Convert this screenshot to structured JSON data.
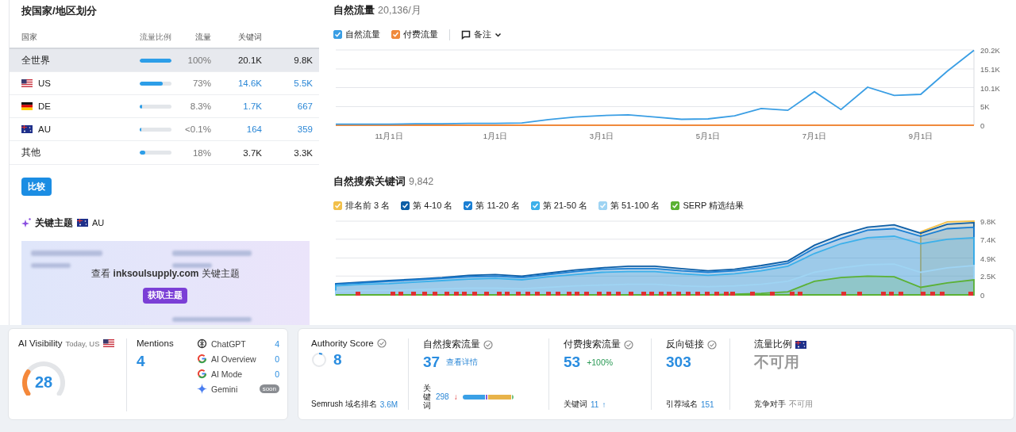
{
  "country_panel": {
    "title": "按国家/地区划分",
    "columns": [
      "国家",
      "流量比例",
      "流量",
      "关键词"
    ],
    "rows": [
      {
        "name": "全世界",
        "level": 1,
        "share": "100%",
        "traffic": "20.1K",
        "keywords": "9.8K",
        "linked": false,
        "selected": true
      },
      {
        "name": "US",
        "level": 0.73,
        "share": "73%",
        "traffic": "14.6K",
        "keywords": "5.5K",
        "linked": true,
        "selected": false
      },
      {
        "name": "DE",
        "level": 0.083,
        "share": "8.3%",
        "traffic": "1.7K",
        "keywords": "667",
        "linked": true,
        "selected": false
      },
      {
        "name": "AU",
        "level": 0.01,
        "share": "<0.1%",
        "traffic": "164",
        "keywords": "359",
        "linked": true,
        "selected": false
      },
      {
        "name": "其他",
        "level": 0.18,
        "share": "18%",
        "traffic": "3.7K",
        "keywords": "3.3K",
        "linked": false,
        "selected": false
      }
    ],
    "compare_button": "比较"
  },
  "topics": {
    "title": "关键主题",
    "country": "AU",
    "prompt": "查看 **inksoulsupply.com** 关键主题",
    "button": "获取主题"
  },
  "traffic_chart": {
    "title": "自然流量",
    "value": "20,136/月",
    "legend_checked": [
      true,
      true
    ],
    "notes_label": "备注",
    "chart_data": {
      "type": "line",
      "grid": true,
      "categories": [
        null,
        null,
        "11月1日",
        null,
        null,
        null,
        "1月1日",
        null,
        null,
        null,
        "3月1日",
        null,
        null,
        null,
        "5月1日",
        null,
        null,
        null,
        "7月1日",
        null,
        null,
        null,
        "9月1日",
        null,
        null
      ],
      "ylim": [
        0,
        20.2
      ],
      "yticks": [
        {
          "value": 0,
          "label": "0"
        },
        {
          "value": 5,
          "label": "5K"
        },
        {
          "value": 10.1,
          "label": "10.1K"
        },
        {
          "value": 15.1,
          "label": "15.1K"
        },
        {
          "value": 20.2,
          "label": "20.2K"
        }
      ],
      "series": [
        {
          "name": "自然流量",
          "color": "#3a9ee4",
          "values": [
            0.3,
            0.3,
            0.3,
            0.4,
            0.4,
            0.5,
            0.5,
            0.6,
            1.5,
            2.2,
            2.6,
            2.8,
            2.2,
            1.6,
            1.7,
            2.5,
            4.5,
            4.0,
            9.0,
            4.2,
            10.2,
            8.0,
            8.3,
            14.5,
            20.1
          ]
        },
        {
          "name": "付费流量",
          "color": "#f08a3c",
          "values": [
            0,
            0,
            0,
            0,
            0,
            0,
            0,
            0,
            0,
            0,
            0,
            0,
            0,
            0,
            0,
            0,
            0,
            0,
            0,
            0,
            0,
            0,
            0,
            0,
            0
          ]
        }
      ]
    }
  },
  "keywords_chart": {
    "title": "自然搜索关键词",
    "value": "9,842",
    "legend_checked": [
      true,
      true,
      true,
      true,
      true,
      true
    ],
    "chart_data": {
      "type": "area",
      "stacked": false,
      "grid": true,
      "categories": [
        null,
        null,
        null,
        null,
        null,
        null,
        null,
        null,
        null,
        null,
        null,
        null,
        null,
        null,
        null,
        null,
        null,
        null,
        null,
        null,
        null,
        null,
        null,
        null,
        null
      ],
      "ylim": [
        0,
        9.8
      ],
      "yticks": [
        {
          "value": 0,
          "label": "0"
        },
        {
          "value": 2.5,
          "label": "2.5K"
        },
        {
          "value": 4.9,
          "label": "4.9K"
        },
        {
          "value": 7.4,
          "label": "7.4K"
        },
        {
          "value": 9.8,
          "label": "9.8K"
        }
      ],
      "series": [
        {
          "name": "排名前 3 名",
          "color": "#f2c04a",
          "values": [
            null,
            null,
            null,
            null,
            null,
            null,
            null,
            null,
            null,
            null,
            null,
            null,
            null,
            null,
            null,
            null,
            null,
            null,
            null,
            null,
            null,
            null,
            8.4,
            9.7,
            9.8
          ]
        },
        {
          "name": "第 4-10 名",
          "color": "#0d5ea6",
          "values": [
            1.5,
            1.7,
            1.9,
            2.1,
            2.3,
            2.6,
            2.7,
            2.5,
            2.9,
            3.3,
            3.6,
            3.8,
            3.8,
            3.5,
            3.2,
            3.4,
            3.9,
            4.5,
            6.6,
            8.0,
            9.0,
            9.3,
            8.2,
            9.4,
            9.6
          ]
        },
        {
          "name": "第 11-20 名",
          "color": "#1b7fd3",
          "values": [
            1.4,
            1.6,
            1.8,
            2.0,
            2.2,
            2.4,
            2.5,
            2.3,
            2.7,
            3.1,
            3.4,
            3.5,
            3.5,
            3.2,
            3.0,
            3.2,
            3.6,
            4.2,
            6.2,
            7.5,
            8.6,
            8.8,
            7.8,
            8.8,
            9.0
          ]
        },
        {
          "name": "第 21-50 名",
          "color": "#3cb0ea",
          "values": [
            1.2,
            1.4,
            1.5,
            1.7,
            1.9,
            2.1,
            2.2,
            2.0,
            2.4,
            2.7,
            3.0,
            3.1,
            3.1,
            2.8,
            2.6,
            2.8,
            3.2,
            3.8,
            5.5,
            6.8,
            7.6,
            7.8,
            6.8,
            7.4,
            7.6
          ]
        },
        {
          "name": "第 51-100 名",
          "color": "#9fd4f3",
          "values": [
            0.5,
            0.6,
            0.6,
            0.7,
            0.8,
            0.9,
            0.9,
            0.8,
            1.0,
            1.2,
            1.3,
            1.4,
            1.4,
            1.2,
            1.1,
            1.2,
            1.4,
            1.8,
            3.0,
            3.6,
            4.0,
            4.1,
            3.0,
            3.6,
            3.9
          ]
        },
        {
          "name": "SERP 精选结果",
          "color": "#5bb134",
          "values": [
            0,
            0,
            0,
            0,
            0,
            0,
            0,
            0,
            0,
            0,
            0,
            0,
            0,
            0,
            0,
            0.1,
            0.2,
            0.4,
            1.8,
            2.3,
            2.5,
            2.4,
            1.0,
            1.6,
            2.0
          ]
        }
      ]
    }
  },
  "ai_visibility": {
    "title": "AI Visibility",
    "subtitle": "Today, US",
    "score": "28",
    "mentions_label": "Mentions",
    "mentions": "4",
    "sources": [
      {
        "kind": "count",
        "name": "ChatGPT",
        "value": "4"
      },
      {
        "kind": "count",
        "name": "AI Overview",
        "value": "0"
      },
      {
        "kind": "count",
        "name": "AI Mode",
        "value": "0"
      },
      {
        "kind": "badge",
        "name": "Gemini",
        "value": "soon"
      }
    ]
  },
  "metrics": {
    "authority": {
      "label": "Authority Score",
      "value": "8",
      "rank_label": "Semrush 域名排名",
      "rank": "3.6M"
    },
    "organic": {
      "label": "自然搜索流量",
      "value": "37",
      "link": "查看详情",
      "keywords_label": "关键词",
      "keywords": "298",
      "trend": "↓",
      "segments": [
        {
          "color": "#3aa0e6",
          "level": 0.46
        },
        {
          "color": "#8a5cd6",
          "level": 0.03
        },
        {
          "color": "#e8b34a",
          "level": 0.47
        },
        {
          "color": "#6cc07a",
          "level": 0.02
        }
      ]
    },
    "paid": {
      "label": "付费搜索流量",
      "value": "53",
      "change": "+100%",
      "keywords_label": "关键词",
      "keywords": "11",
      "trend": "↑"
    },
    "backlinks": {
      "label": "反向链接",
      "value": "303",
      "domains_label": "引荐域名",
      "domains": "151"
    },
    "share": {
      "label": "流量比例",
      "value": "不可用",
      "competitors_label": "竞争对手",
      "competitors": "不可用"
    }
  }
}
